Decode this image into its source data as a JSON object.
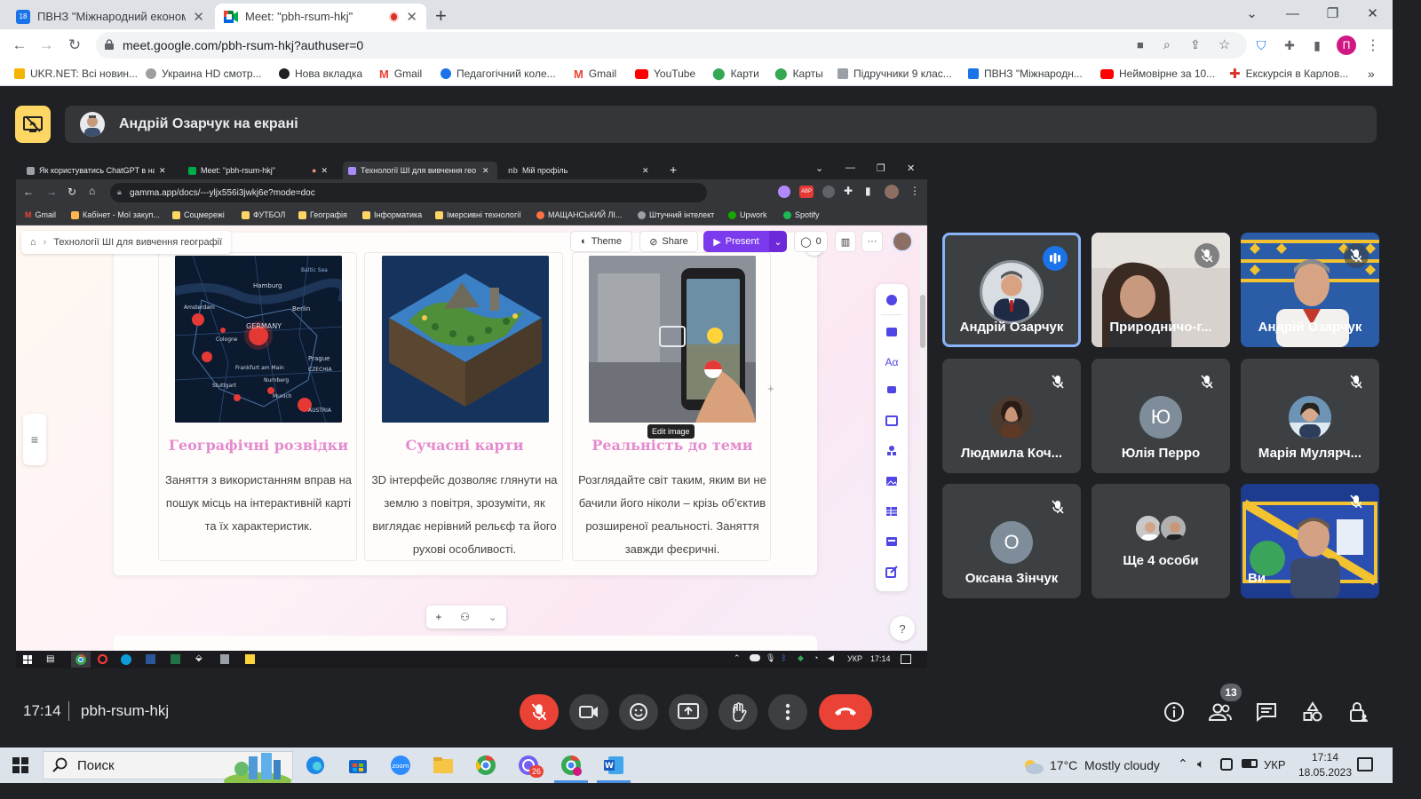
{
  "chrome": {
    "tabs": [
      {
        "title": "ПВНЗ \"Міжнародний економіко",
        "fav_color": "#1a73e8",
        "fav_text": "18",
        "active": false
      },
      {
        "title": "Meet: \"pbh-rsum-hkj\"",
        "fav_color": "#00897b",
        "fav_text": "",
        "active": true,
        "recording": true
      }
    ],
    "new_tab": "+",
    "window": {
      "chevron": "⌄",
      "minimize": "—",
      "restore": "❐",
      "close": "✕"
    },
    "url": "meet.google.com/pbh-rsum-hkj?authuser=0",
    "profile_letter": "П",
    "bookmarks": [
      {
        "label": "UKR.NET: Всі новин...",
        "color": "#f4b400"
      },
      {
        "label": "Украина HD смотр...",
        "color": "#9e9e9e"
      },
      {
        "label": "Нова вкладка",
        "color": "#202124"
      },
      {
        "label": "Gmail",
        "color": "#ea4335"
      },
      {
        "label": "Педагогічний коле...",
        "color": "#1a73e8"
      },
      {
        "label": "Gmail",
        "color": "#ea4335"
      },
      {
        "label": "YouTube",
        "color": "#ff0000"
      },
      {
        "label": "Карти",
        "color": "#34a853"
      },
      {
        "label": "Карты",
        "color": "#34a853"
      },
      {
        "label": "Підручники 9 клас...",
        "color": "#5f6368"
      },
      {
        "label": "ПВНЗ \"Міжнародн...",
        "color": "#1a73e8"
      },
      {
        "label": "Неймовірне за 10...",
        "color": "#ff0000"
      },
      {
        "label": "Екскурсія в Карлов...",
        "color": "#d93025"
      }
    ],
    "more": "»"
  },
  "meet": {
    "presenter_label": "Андрій Озарчук на екрані",
    "time": "17:14",
    "meeting_code": "pbh-rsum-hkj",
    "participants_badge": "13",
    "tiles": [
      {
        "name": "Андрій Озарчук",
        "type": "photo",
        "speaking": true,
        "avatar_color": "#7a8da6"
      },
      {
        "name": "Природничо-г...",
        "type": "video",
        "muted": true
      },
      {
        "name": "Андрій Озарчук",
        "type": "video2",
        "muted": true
      },
      {
        "name": "Людмила Коч...",
        "type": "photo",
        "muted": true,
        "avatar_color": "#6b4a3a"
      },
      {
        "name": "Юлія Перро",
        "type": "letter",
        "letter": "Ю",
        "muted": true,
        "avatar_color": "#7f8c99"
      },
      {
        "name": "Марія Мулярч...",
        "type": "photo",
        "muted": true,
        "avatar_color": "#4a6e8a"
      },
      {
        "name": "Оксана Зінчук",
        "type": "letter",
        "letter": "О",
        "muted": true,
        "avatar_color": "#7f8c99"
      },
      {
        "name": "Ще 4 особи",
        "type": "more"
      },
      {
        "name": "Ви",
        "type": "video3",
        "muted": true
      }
    ]
  },
  "shared": {
    "tabs": [
      {
        "title": "Як користуватись ChatGPT в на",
        "active": false
      },
      {
        "title": "Meet: \"pbh-rsum-hkj\"",
        "active": false
      },
      {
        "title": "Технології ШІ для вивчення гео",
        "active": true
      },
      {
        "title": "Мій профіль",
        "active": false
      }
    ],
    "url": "gamma.app/docs/---yljx556i3jwkj6e?mode=doc",
    "bookmarks": [
      "Gmail",
      "Кабінет - Мої закуп...",
      "Соцмережі",
      "ФУТБОЛ",
      "Географія",
      "Інформатика",
      "Імерсивні технології",
      "МАЩАНСЬКИЙ ЛІ...",
      "Штучний інтелект",
      "Upwork",
      "Spotify"
    ],
    "gamma": {
      "breadcrumb": "Технології ШІ для вивчення географії",
      "theme": "Theme",
      "share": "Share",
      "present": "Present",
      "comments": "0",
      "tooltip": "Edit image",
      "help": "?",
      "cards": [
        {
          "title": "Географічні розвідки",
          "text": "Заняття з використанням вправ на пошук місць на інтерактивній карті та їх характеристик."
        },
        {
          "title": "Сучасні карти",
          "text": "3D інтерфейс дозволяє глянути на землю з повітря, зрозуміти, як виглядає нерівний рельєф та його рухові особливості."
        },
        {
          "title": "Реальність до теми",
          "text": "Розглядайте світ таким, яким ви не бачили його ніколи – крізь об'єктив розширеної реальності. Заняття завжди феєричні."
        }
      ],
      "map_labels": [
        "Hamburg",
        "Berlin",
        "Baltic Sea",
        "Amsterdam",
        "GERMANY",
        "Frankfurt am Main",
        "Prague",
        "Nurnberg",
        "CZECHIA",
        "Munich",
        "Stuttgart",
        "AUSTRIA",
        "Cologne"
      ]
    },
    "taskbar": {
      "lang": "УКР",
      "time": "17:14"
    }
  },
  "windows": {
    "search": "Поиск",
    "weather": "17°C  Mostly cloudy",
    "lang": "УКР",
    "time": "17:14",
    "date": "18.05.2023",
    "badge": "26"
  }
}
